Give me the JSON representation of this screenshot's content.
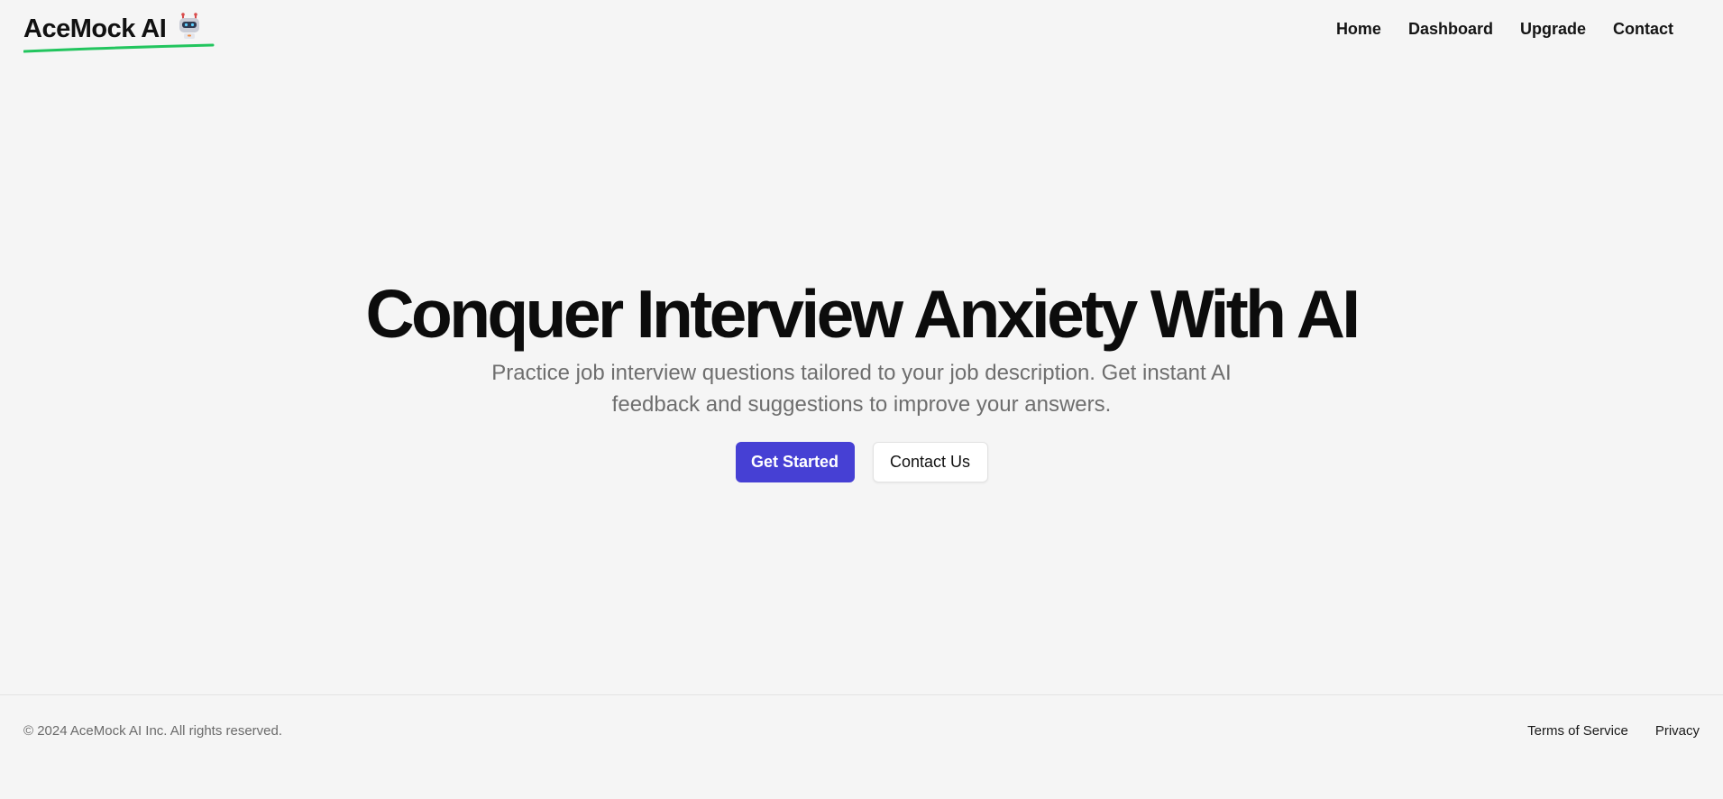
{
  "header": {
    "logo_text": "AceMock AI",
    "logo_icon": "robot-icon",
    "nav": [
      {
        "label": "Home"
      },
      {
        "label": "Dashboard"
      },
      {
        "label": "Upgrade"
      },
      {
        "label": "Contact"
      }
    ]
  },
  "hero": {
    "title": "Conquer Interview Anxiety With AI",
    "subtitle": "Practice job interview questions tailored to your job description. Get instant AI feedback and suggestions to improve your answers.",
    "primary_button": "Get Started",
    "secondary_button": "Contact Us"
  },
  "footer": {
    "copyright": "© 2024 AceMock AI Inc. All rights reserved.",
    "links": [
      {
        "label": "Terms of Service"
      },
      {
        "label": "Privacy"
      }
    ]
  },
  "colors": {
    "background": "#f5f5f5",
    "primary": "#4640d4",
    "logo_underline": "#22c55e",
    "subtitle": "#6e6e6e"
  }
}
